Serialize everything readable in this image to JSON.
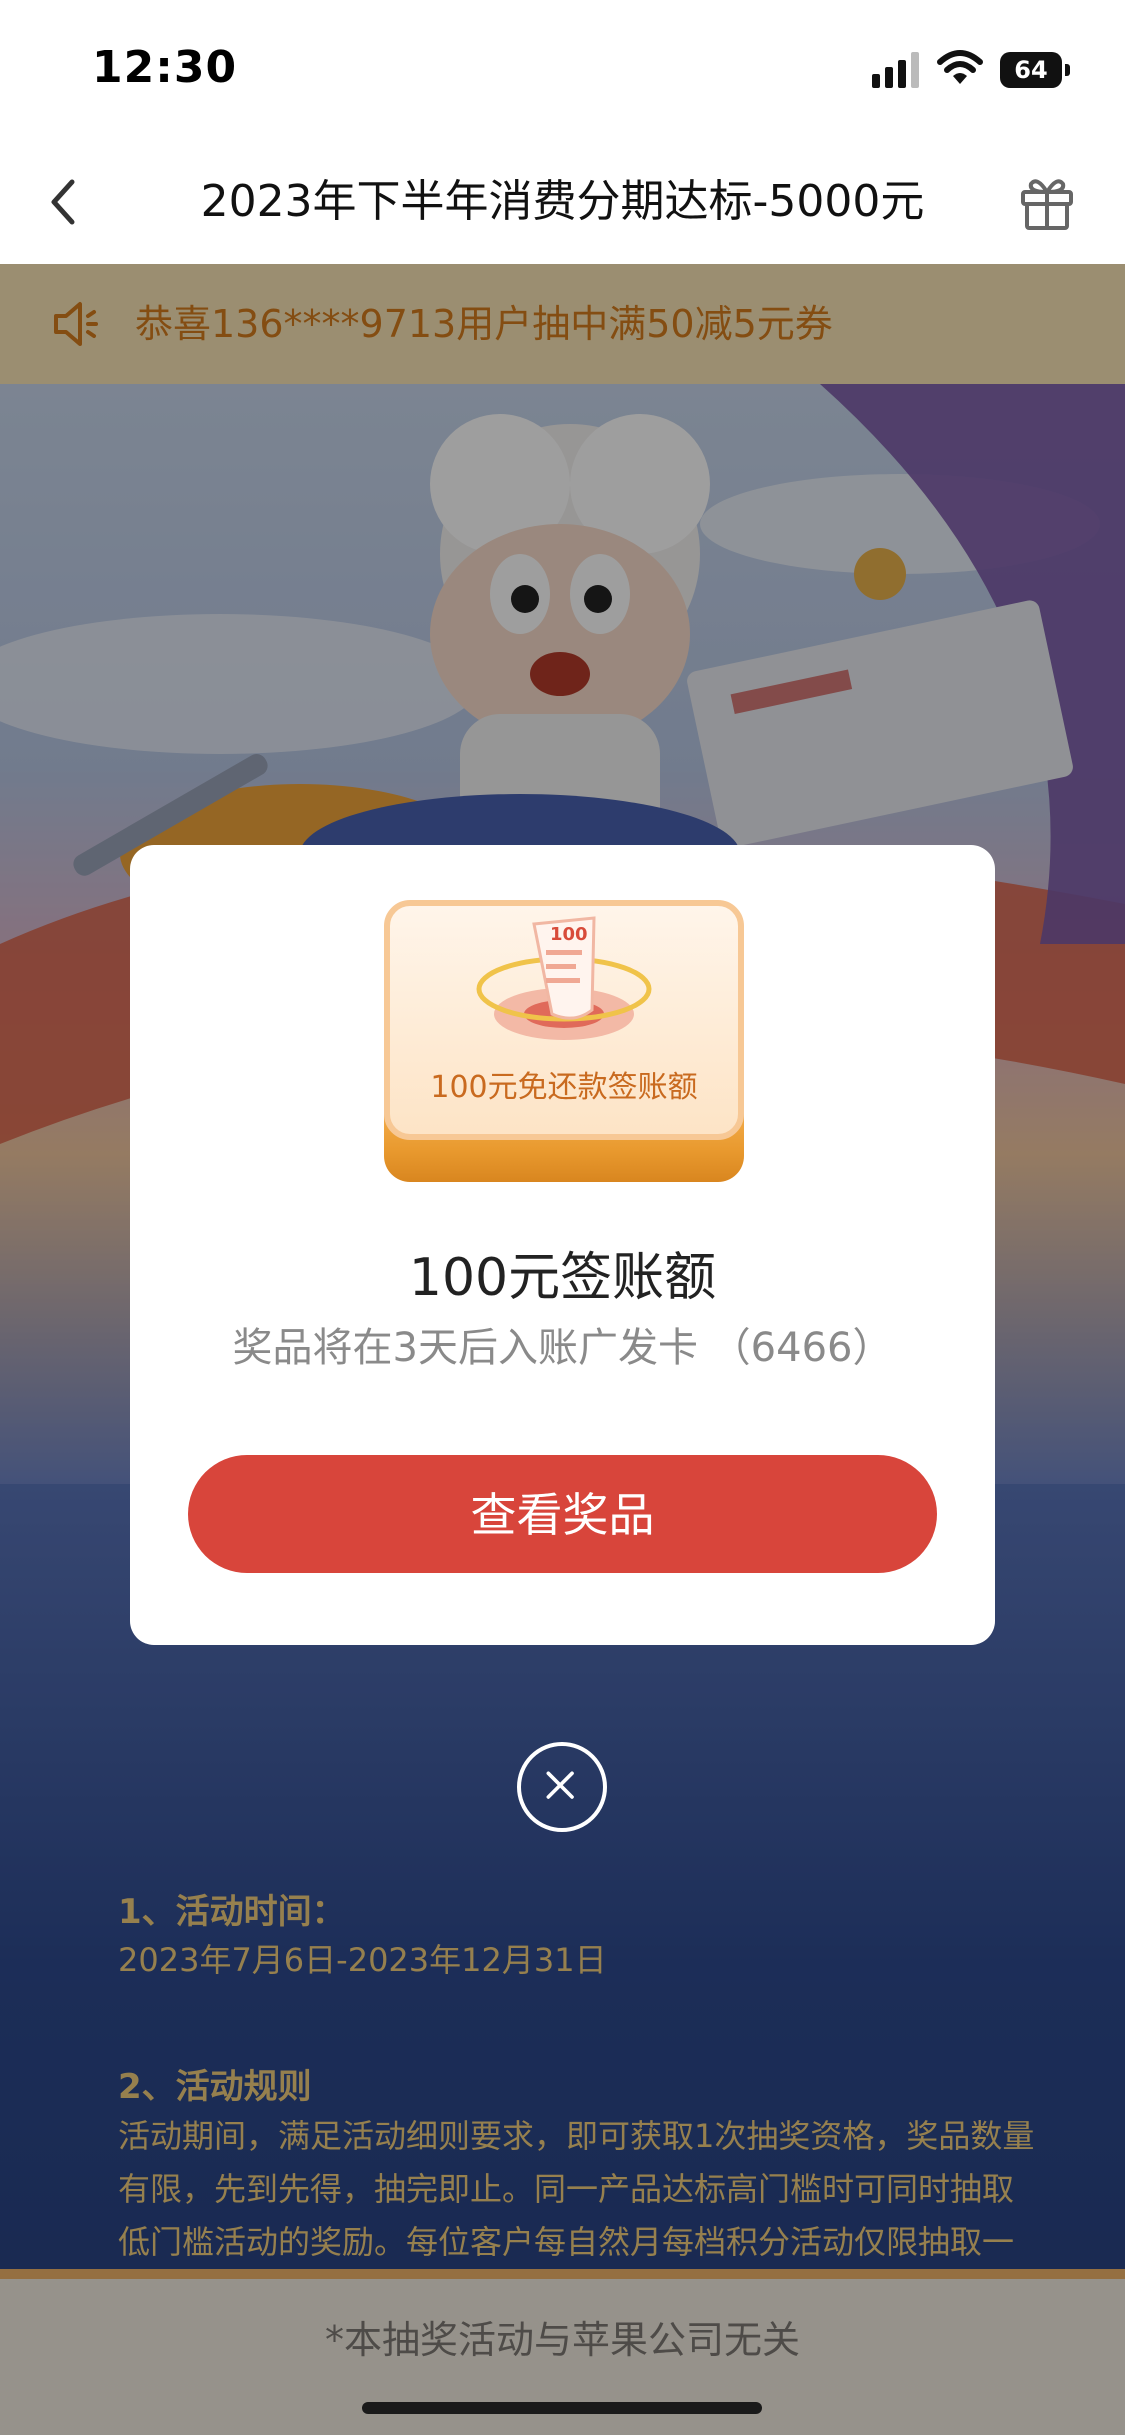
{
  "status_bar": {
    "time": "12:30",
    "battery": "64"
  },
  "nav": {
    "title": "2023年下半年消费分期达标-5000元"
  },
  "marquee": {
    "text": "恭喜136****9713用户抽中满50减5元券"
  },
  "rules": {
    "section1_heading": "1、活动时间：",
    "section1_text": "2023年7月6日-2023年12月31日",
    "section2_heading": "2、活动规则",
    "section2_text": "活动期间，满足活动细则要求，即可获取1次抽奖资格，奖品数量有限，先到先得，抽完即止。同一产品达标高门槛时可同时抽取低门槛活动的奖励。每位客户每自然月每档积分活动仅限抽取一次。"
  },
  "footer": {
    "text": "*本抽奖活动与苹果公司无关"
  },
  "modal": {
    "card_badge": "100",
    "card_label": "100元免还款签账额",
    "title": "100元签账额",
    "subtitle": "奖品将在3天后入账广发卡 （6466）",
    "button_label": "查看奖品"
  },
  "colors": {
    "button": "#d8453b",
    "marquee_text": "#d67c1e",
    "rules_text": "#f3cf7e"
  },
  "icons": [
    "back-icon",
    "gift-icon",
    "speaker-icon",
    "close-icon"
  ]
}
